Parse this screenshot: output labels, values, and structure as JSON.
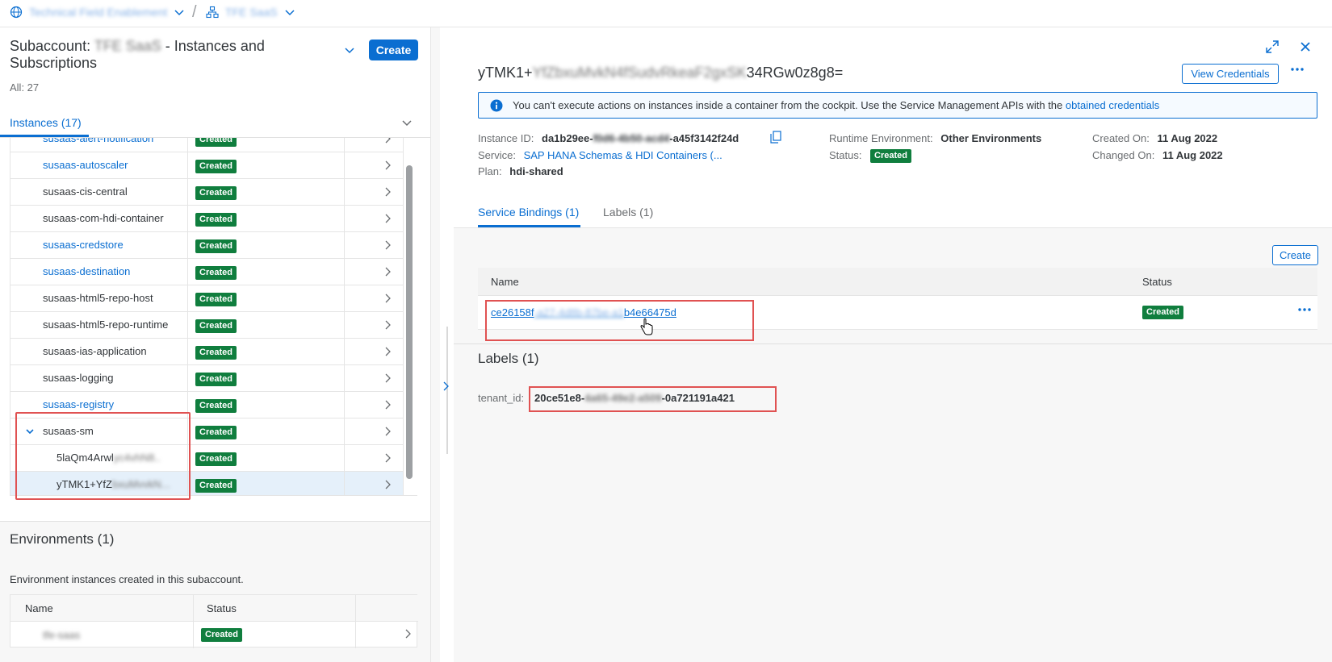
{
  "breadcrumb": {
    "global_account": "Technical Field Enablement",
    "subaccount": "TFE SaaS"
  },
  "left_panel": {
    "title_prefix": "Subaccount:",
    "title_blurred": "TFE SaaS",
    "title_suffix": " - Instances and Subscriptions",
    "count": "All: 27",
    "create_label": "Create",
    "instances_tab": "Instances (17)",
    "rows": [
      {
        "name": "susaas-alert-notification",
        "link": true,
        "status": "Created"
      },
      {
        "name": "susaas-autoscaler",
        "link": true,
        "status": "Created"
      },
      {
        "name": "susaas-cis-central",
        "link": false,
        "status": "Created"
      },
      {
        "name": "susaas-com-hdi-container",
        "link": false,
        "status": "Created"
      },
      {
        "name": "susaas-credstore",
        "link": true,
        "status": "Created"
      },
      {
        "name": "susaas-destination",
        "link": true,
        "status": "Created"
      },
      {
        "name": "susaas-html5-repo-host",
        "link": false,
        "status": "Created"
      },
      {
        "name": "susaas-html5-repo-runtime",
        "link": false,
        "status": "Created"
      },
      {
        "name": "susaas-ias-application",
        "link": false,
        "status": "Created"
      },
      {
        "name": "susaas-logging",
        "link": false,
        "status": "Created"
      },
      {
        "name": "susaas-registry",
        "link": true,
        "status": "Created"
      },
      {
        "name": "susaas-sm",
        "link": false,
        "status": "Created",
        "expanded": true
      },
      {
        "name": "5laQm4Arwl",
        "name_blurred": "yc4vhN8..",
        "link": false,
        "status": "Created",
        "child": true
      },
      {
        "name": "yTMK1+YfZ",
        "name_blurred": "bxuMvvkN...",
        "link": false,
        "status": "Created",
        "child": true,
        "selected": true
      }
    ],
    "environments": {
      "title": "Environments (1)",
      "description": "Environment instances created in this subaccount.",
      "col_name": "Name",
      "col_status": "Status",
      "row_name": "tfe-saas",
      "row_status": "Created"
    }
  },
  "detail": {
    "title_start": "yTMK1+",
    "title_blurred": "YfZbxuMvkN4fSudvRkeaF2gxSK",
    "title_end": "34RGw0z8g8=",
    "view_credentials": "View Credentials",
    "info_text": "You can't execute actions on instances inside a container from the cockpit. Use the Service Management APIs with the ",
    "info_link": "obtained credentials",
    "instance_id_label": "Instance ID:",
    "instance_id_start": "da1b29ee-",
    "instance_id_blurred": "f0d6-4b50-acd4",
    "instance_id_end": "-a45f3142f24d",
    "service_label": "Service:",
    "service_value": "SAP HANA Schemas & HDI Containers (...",
    "plan_label": "Plan:",
    "plan_value": "hdi-shared",
    "runtime_label": "Runtime Environment:",
    "runtime_value": "Other Environments",
    "status_label": "Status:",
    "status_value": "Created",
    "created_label": "Created On:",
    "created_value": "11 Aug 2022",
    "changed_label": "Changed On:",
    "changed_value": "11 Aug 2022",
    "tab_bindings": "Service Bindings (1)",
    "tab_labels": "Labels (1)",
    "bindings_create": "Create",
    "bindings_col_name": "Name",
    "bindings_col_status": "Status",
    "binding_name_start": "ce26158f",
    "binding_name_blurred": "-a27-4d8b-87be-a1",
    "binding_name_end": "b4e66475d",
    "binding_status": "Created",
    "labels_title": "Labels (1)",
    "tenant_key": "tenant_id:",
    "tenant_start": "20ce51e8-",
    "tenant_blurred": "4a65-49e2-a509",
    "tenant_end": "-0a721191a421"
  },
  "colors": {
    "accent": "#0a6ed1",
    "success": "#107e3e",
    "highlight": "#e05252"
  }
}
